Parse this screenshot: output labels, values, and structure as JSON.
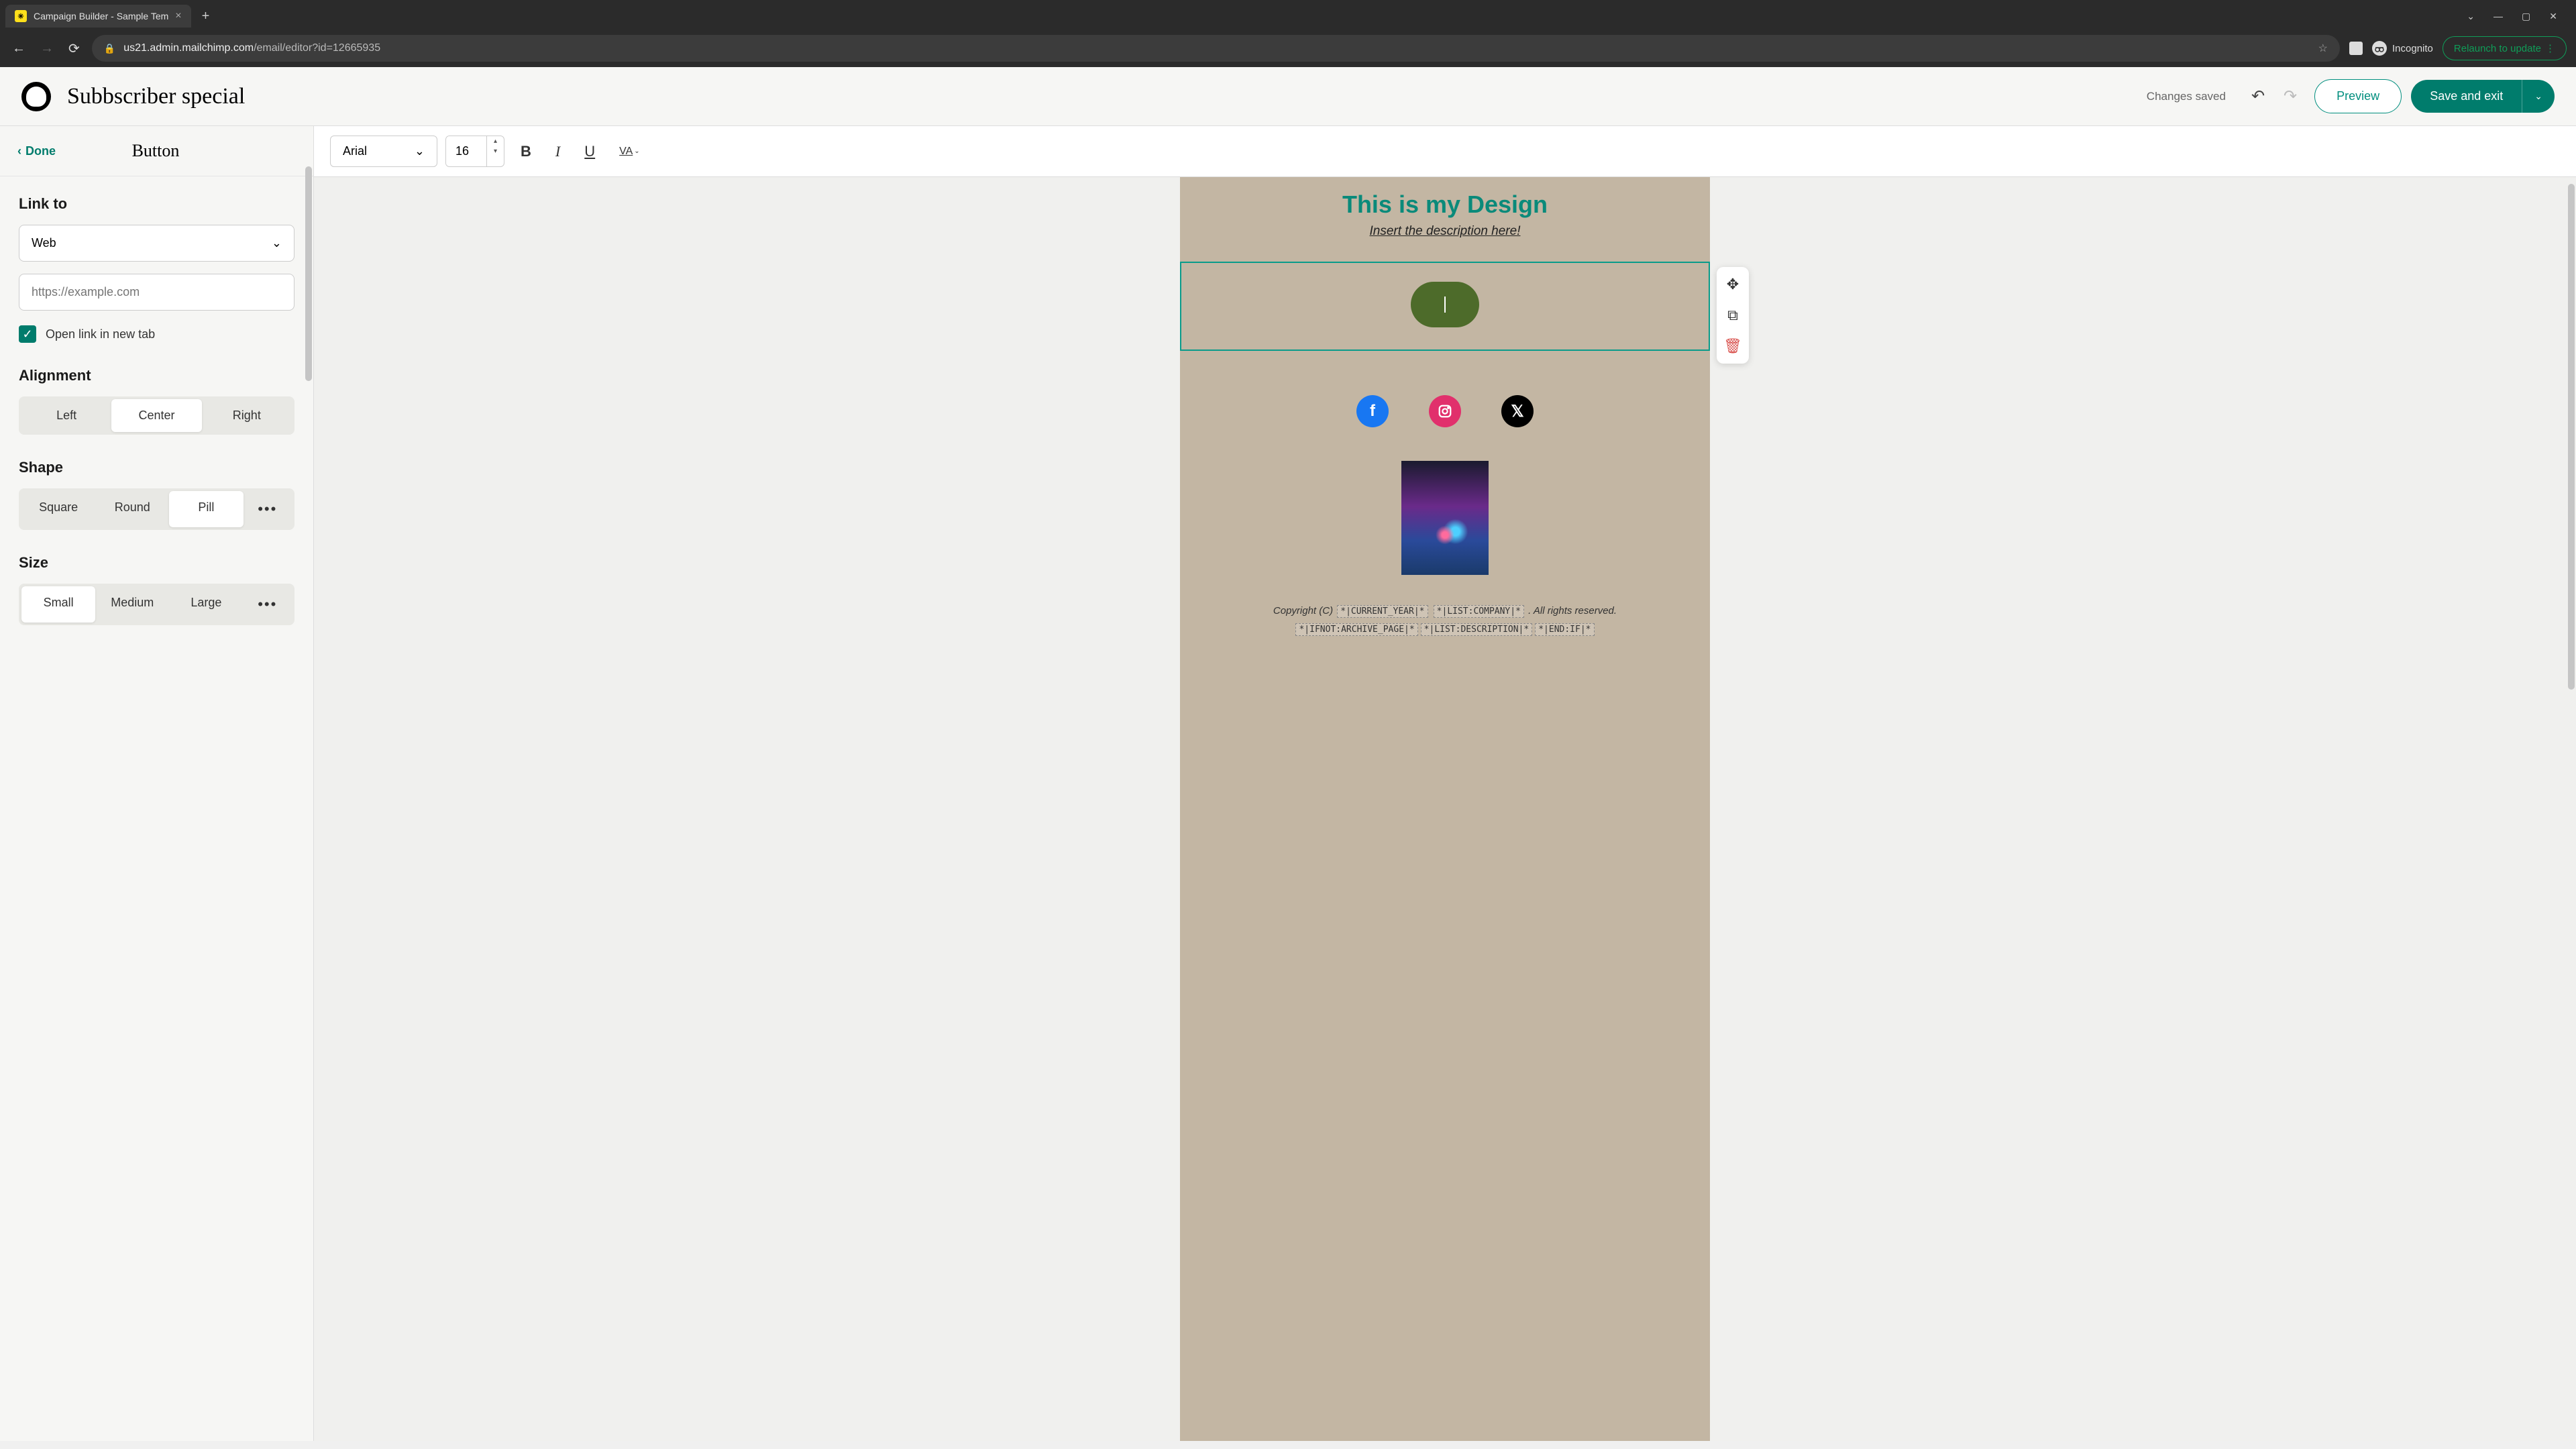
{
  "browser": {
    "tab_title": "Campaign Builder - Sample Tem",
    "url_domain": "us21.admin.mailchimp.com",
    "url_path": "/email/editor?id=12665935",
    "incognito_label": "Incognito",
    "relaunch_label": "Relaunch to update"
  },
  "header": {
    "campaign_title": "Subbscriber special",
    "status": "Changes saved",
    "preview_label": "Preview",
    "save_exit_label": "Save and exit"
  },
  "sidebar": {
    "done_label": "Done",
    "title": "Button",
    "link_to_label": "Link to",
    "link_to_value": "Web",
    "url_placeholder": "https://example.com",
    "open_new_tab_label": "Open link in new tab",
    "open_new_tab_checked": true,
    "alignment_label": "Alignment",
    "alignment_options": [
      "Left",
      "Center",
      "Right"
    ],
    "alignment_selected": "Center",
    "shape_label": "Shape",
    "shape_options": [
      "Square",
      "Round",
      "Pill"
    ],
    "shape_selected": "Pill",
    "size_label": "Size",
    "size_options": [
      "Small",
      "Medium",
      "Large"
    ],
    "size_selected": "Small"
  },
  "toolbar": {
    "font_family": "Arial",
    "font_size": "16"
  },
  "canvas": {
    "title": "This is my Design",
    "subtitle": "Insert the description here!",
    "footer_prefix": "Copyright (C) ",
    "merge_year": "*|CURRENT_YEAR|*",
    "merge_company": "*|LIST:COMPANY|*",
    "footer_suffix": ". All rights reserved.",
    "merge_ifnot": "*|IFNOT:ARCHIVE_PAGE|*",
    "merge_desc": "*|LIST:DESCRIPTION|*",
    "merge_endif": "*|END:IF|*"
  }
}
